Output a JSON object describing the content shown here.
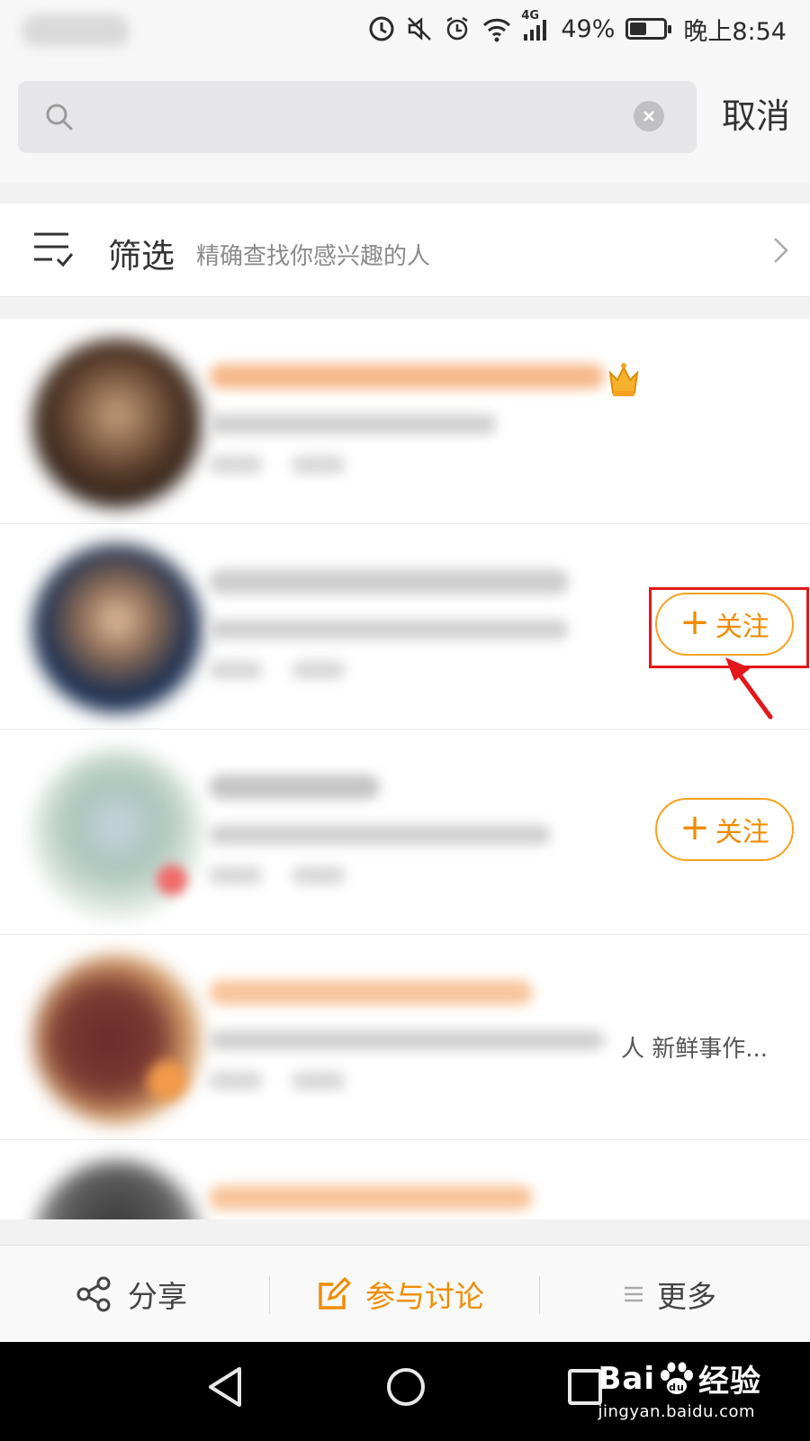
{
  "status_bar": {
    "battery_percent": "49%",
    "battery_level": 0.49,
    "network_label": "4G",
    "time": "晚上8:54"
  },
  "search": {
    "cancel_label": "取消"
  },
  "filter": {
    "title": "筛选",
    "subtitle": "精确查找你感兴趣的人"
  },
  "results": [
    {
      "follow_visible": false,
      "has_vip_badge": true
    },
    {
      "follow_label": "关注",
      "follow_visible": true
    },
    {
      "follow_label": "关注",
      "follow_visible": true
    },
    {
      "side_text": "人 新鲜事作..."
    },
    {}
  ],
  "action_bar": {
    "share_label": "分享",
    "discuss_label": "参与讨论",
    "more_label": "更多"
  },
  "watermark": {
    "brand": "Bai",
    "brand_cn": "经验",
    "url": "jingyan.baidu.com"
  },
  "colors": {
    "accent": "#f08c00",
    "highlight": "#e4171b"
  }
}
